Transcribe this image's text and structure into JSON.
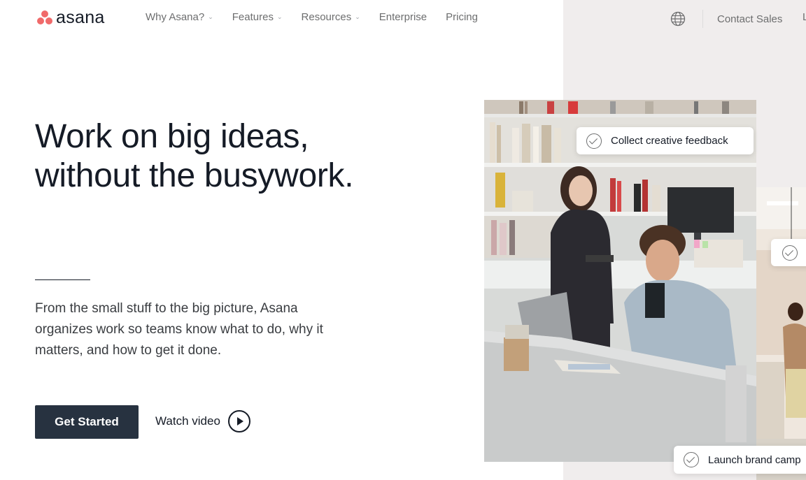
{
  "brand": {
    "name": "asana",
    "accent": "#f06a6a"
  },
  "nav": {
    "links": [
      {
        "label": "Why Asana?",
        "dropdown": true
      },
      {
        "label": "Features",
        "dropdown": true
      },
      {
        "label": "Resources",
        "dropdown": true
      },
      {
        "label": "Enterprise",
        "dropdown": false
      },
      {
        "label": "Pricing",
        "dropdown": false
      }
    ],
    "globe_icon": "globe-icon",
    "contact_label": "Contact Sales",
    "login_partial": "L"
  },
  "hero": {
    "headline_line1": "Work on big ideas,",
    "headline_line2": "without the busywork.",
    "subtext": "From the small stuff to the big picture, Asana organizes work so teams know what to do, why it matters, and how to get it done.",
    "primary_button": "Get Started",
    "secondary_link": "Watch video",
    "button_color": "#273240"
  },
  "task_cards": [
    {
      "label": "Collect creative feedback"
    },
    {
      "label": ""
    },
    {
      "label": "Launch brand camp"
    }
  ]
}
